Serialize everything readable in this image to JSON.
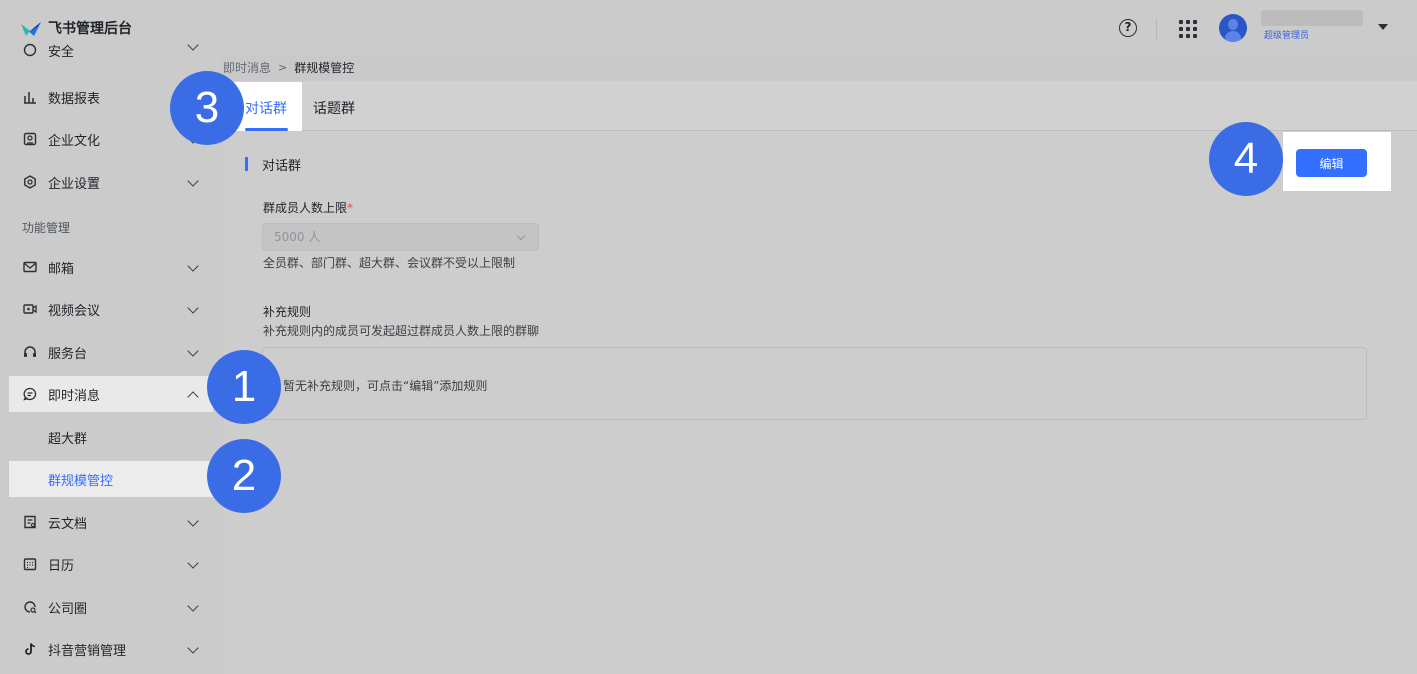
{
  "app": {
    "title": "飞书管理后台",
    "user_role": "超级管理员"
  },
  "colors": {
    "accent": "#3370ff",
    "marker": "#3a6de5",
    "required": "#f54a45"
  },
  "sidebar": {
    "section_title": "功能管理",
    "items": [
      {
        "label": "安全",
        "icon": "shield-icon"
      },
      {
        "label": "数据报表",
        "icon": "bar-chart-icon"
      },
      {
        "label": "企业文化",
        "icon": "culture-icon"
      },
      {
        "label": "企业设置",
        "icon": "settings-icon"
      },
      {
        "label": "邮箱",
        "icon": "mail-icon"
      },
      {
        "label": "视频会议",
        "icon": "video-icon"
      },
      {
        "label": "服务台",
        "icon": "headset-icon"
      },
      {
        "label": "即时消息",
        "icon": "chat-icon"
      },
      {
        "label": "超大群",
        "icon": ""
      },
      {
        "label": "群规模管控",
        "icon": ""
      },
      {
        "label": "云文档",
        "icon": "document-icon"
      },
      {
        "label": "日历",
        "icon": "calendar-icon"
      },
      {
        "label": "公司圈",
        "icon": "moments-icon"
      },
      {
        "label": "抖音营销管理",
        "icon": "tiktok-icon"
      }
    ]
  },
  "breadcrumb": {
    "parent": "即时消息",
    "current": "群规模管控"
  },
  "tabs": [
    {
      "label": "对话群",
      "active": true
    },
    {
      "label": "话题群",
      "active": false
    }
  ],
  "main": {
    "section_heading": "对话群",
    "member_limit_label": "群成员人数上限",
    "required_mark": "*",
    "member_limit_value": "5000 人",
    "member_limit_note": "全员群、部门群、超大群、会议群不受以上限制",
    "rules_title": "补充规则",
    "rules_desc": "补充规则内的成员可发起超过群成员人数上限的群聊",
    "rules_empty": "暂无补充规则，可点击“编辑”添加规则",
    "edit_button": "编辑"
  },
  "markers": [
    "1",
    "2",
    "3",
    "4"
  ]
}
